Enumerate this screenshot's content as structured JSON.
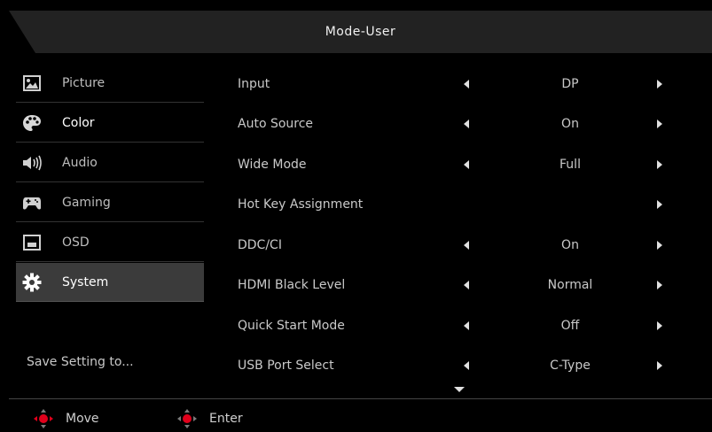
{
  "header": {
    "title": "Mode-User"
  },
  "sidebar": {
    "items": [
      {
        "label": "Picture",
        "icon": "picture-icon"
      },
      {
        "label": "Color",
        "icon": "palette-icon"
      },
      {
        "label": "Audio",
        "icon": "speaker-icon"
      },
      {
        "label": "Gaming",
        "icon": "gamepad-icon"
      },
      {
        "label": "OSD",
        "icon": "osd-window-icon"
      },
      {
        "label": "System",
        "icon": "gear-icon",
        "selected": true
      }
    ],
    "save_setting": "Save Setting to..."
  },
  "settings": [
    {
      "label": "Input",
      "value": "DP"
    },
    {
      "label": "Auto Source",
      "value": "On"
    },
    {
      "label": "Wide Mode",
      "value": "Full"
    },
    {
      "label": "Hot Key Assignment",
      "value": ""
    },
    {
      "label": "DDC/CI",
      "value": "On"
    },
    {
      "label": "HDMI Black Level",
      "value": "Normal"
    },
    {
      "label": "Quick Start Mode",
      "value": "Off"
    },
    {
      "label": "USB Port Select",
      "value": "C-Type"
    }
  ],
  "footer": {
    "move_label": "Move",
    "enter_label": "Enter"
  },
  "colors": {
    "background": "#000000",
    "header": "#222222",
    "selected": "#3b3b3b",
    "accent_red": "#e0001b"
  }
}
